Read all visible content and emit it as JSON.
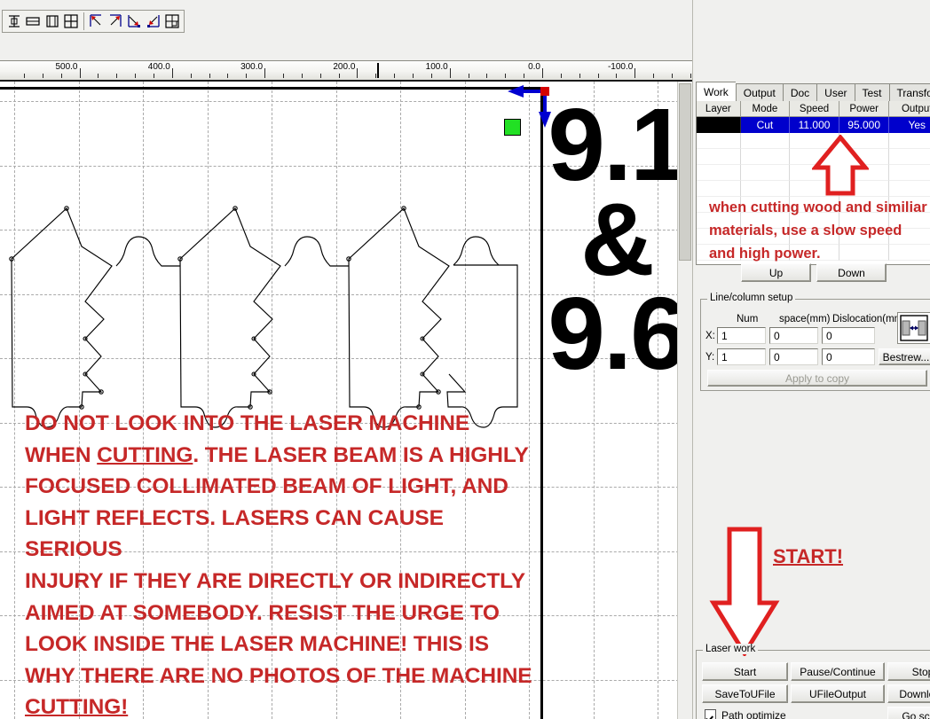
{
  "toolbar": {
    "groups": [
      {
        "name": "align-tools",
        "buttons": [
          {
            "icon": "align-vertical-center-icon",
            "label": "Align vertical center"
          },
          {
            "icon": "align-horizontal-center-icon",
            "label": "Align horizontal center"
          },
          {
            "icon": "same-width-icon",
            "label": "Same width"
          },
          {
            "icon": "same-size-icon",
            "label": "Same size"
          }
        ]
      },
      {
        "name": "corner-tools",
        "buttons": [
          {
            "icon": "align-top-left-icon",
            "label": "Align top left"
          },
          {
            "icon": "align-top-right-icon",
            "label": "Align top right"
          },
          {
            "icon": "align-bottom-right-icon",
            "label": "Align bottom right"
          },
          {
            "icon": "align-bottom-left-icon",
            "label": "Align bottom left"
          },
          {
            "icon": "align-center-icon",
            "label": "Align center"
          }
        ]
      }
    ]
  },
  "ruler": {
    "unit": "mm",
    "labels": [
      "500.0",
      "400.0",
      "300.0",
      "200.0",
      "100.0",
      "0.0",
      "-100.0"
    ],
    "values": [
      500,
      400,
      300,
      200,
      100,
      0,
      -100
    ],
    "direction": "decreasing-left-to-right"
  },
  "canvas": {
    "origin_marker": "laser-origin-point",
    "arrow_left": "origin-direction-x-arrow",
    "arrow_down": "origin-direction-y-arrow",
    "selection_marker": "green-position-square",
    "shapes_description": "jigsaw puzzle piece vector outlines",
    "big_text": "9.1\n&\n9.6",
    "warning_lines": [
      "DO NOT LOOK INTO THE LASER MACHINE",
      "WHEN CUTTING. THE LASER BEAM IS A HIGHLY",
      "FOCUSED COLLIMATED BEAM OF LIGHT, AND",
      "LIGHT REFLECTS. LASERS CAN CAUSE SERIOUS",
      "INJURY IF THEY ARE DIRECTLY OR INDIRECTLY",
      "AIMED AT SOMEBODY. RESIST THE URGE TO",
      "LOOK INSIDE THE LASER MACHINE! THIS IS",
      "WHY THERE ARE NO PHOTOS OF THE MACHINE",
      "CUTTING!"
    ],
    "warning_color": "#c62828"
  },
  "panel": {
    "tabs": [
      {
        "label": "Work",
        "active": true
      },
      {
        "label": "Output",
        "active": false
      },
      {
        "label": "Doc",
        "active": false
      },
      {
        "label": "User",
        "active": false
      },
      {
        "label": "Test",
        "active": false
      },
      {
        "label": "Transform",
        "active": false
      }
    ],
    "layer_table": {
      "columns": [
        "Layer",
        "Mode",
        "Speed",
        "Power",
        "Output"
      ],
      "rows": [
        {
          "layer_color": "#000000",
          "mode": "Cut",
          "speed": "11.000",
          "power": "95.000",
          "output": "Yes",
          "selected": true
        }
      ],
      "selected_row_color": "#0000cc"
    },
    "annotation": {
      "arrow": "up-arrow-annotation",
      "text": "when cutting wood and similiar materials, use a slow speed and high power.",
      "color": "#c62828"
    },
    "order_buttons": [
      {
        "label": "Up"
      },
      {
        "label": "Down"
      }
    ],
    "line_column_setup": {
      "title": "Line/column setup",
      "col_headers": [
        "Num",
        "space(mm)",
        "Dislocation(mm)"
      ],
      "rows": [
        {
          "axis": "X:",
          "num": "1",
          "space": "0",
          "dislocation": "0"
        },
        {
          "axis": "Y:",
          "num": "1",
          "space": "0",
          "dislocation": "0"
        }
      ],
      "bestrew_label": "Bestrew...",
      "apply_label": "Apply to copy",
      "spacing_icon": "object-spacing-icon"
    },
    "start_annotation": {
      "arrow": "down-arrow-annotation",
      "label": "START!",
      "color": "#c62828"
    },
    "laser_work": {
      "title": "Laser work",
      "buttons": [
        [
          "Start",
          "Pause/Continue",
          "Stop"
        ],
        [
          "SaveToUFile",
          "UFileOutput",
          "Download"
        ]
      ],
      "checkbox": {
        "label": "Path optimize",
        "checked": true
      },
      "go_scale_label": "Go scale"
    }
  }
}
